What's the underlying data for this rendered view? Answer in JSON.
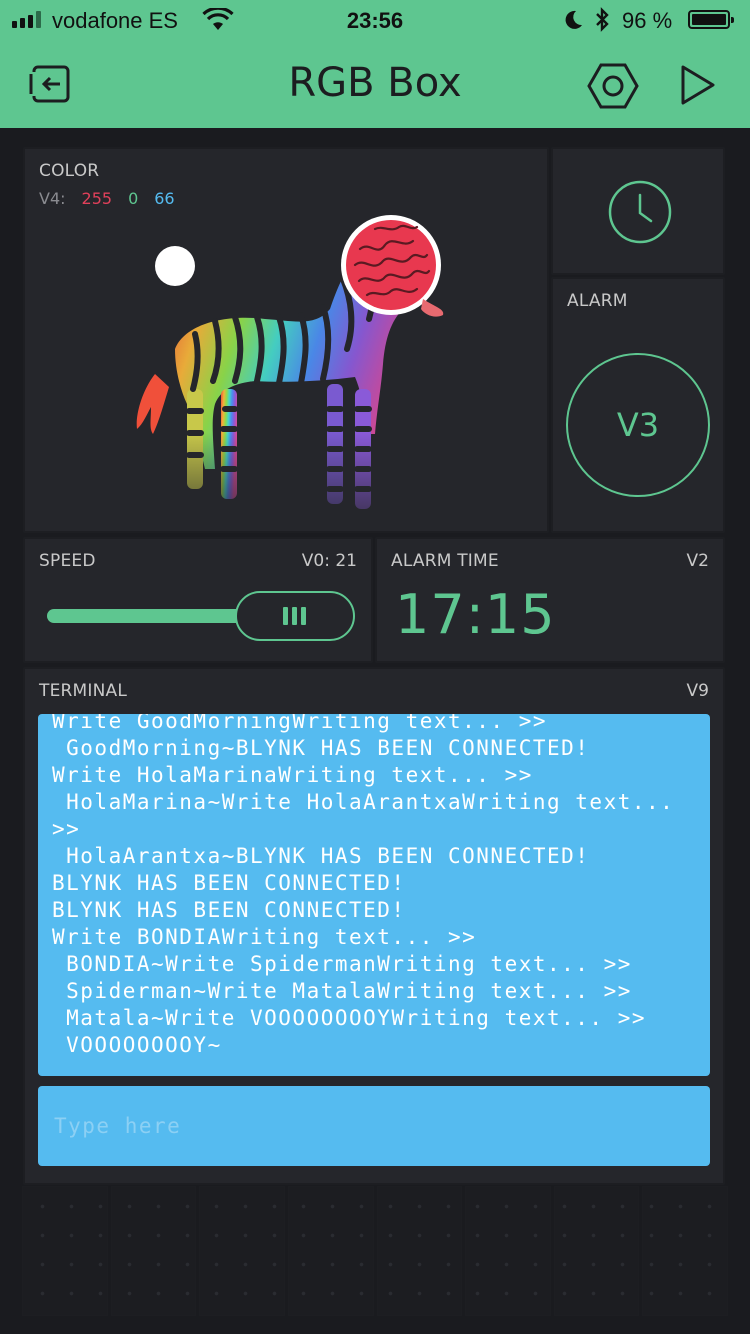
{
  "status_bar": {
    "carrier": "vodafone ES",
    "time": "23:56",
    "battery_percent": "96 %",
    "battery_level": 0.96,
    "icons": [
      "signal-icon",
      "wifi-icon",
      "moon-icon",
      "bluetooth-icon",
      "battery-icon"
    ]
  },
  "navbar": {
    "title": "RGB Box",
    "left_icon": "exit-icon",
    "right_icons": [
      "settings-hexagon-icon",
      "play-icon"
    ]
  },
  "colors": {
    "accent": "#5ec690",
    "panel": "#25262b",
    "background": "#1a1b1f",
    "terminal": "#55bbf0",
    "red_value": "#e0405a",
    "green_value": "#5ec690",
    "blue_value": "#55bbf0"
  },
  "color_widget": {
    "label": "COLOR",
    "pin": "V4:",
    "r": "255",
    "g": "0",
    "b": "66",
    "selected_color": "#e8384f"
  },
  "timer_widget": {
    "icon": "clock-icon"
  },
  "alarm_widget": {
    "label": "ALARM",
    "button_label": "V3"
  },
  "speed_widget": {
    "label": "SPEED",
    "value_label": "V0: 21",
    "slider_fraction": 0.9
  },
  "alarm_time_widget": {
    "label": "ALARM TIME",
    "pin": "V2",
    "value": "17:15"
  },
  "terminal": {
    "label": "TERMINAL",
    "pin": "V9",
    "lines": [
      "Write GoodMorningWriting text... >>",
      " GoodMorning~BLYNK HAS BEEN CONNECTED!",
      "Write HolaMarinaWriting text... >>",
      " HolaMarina~Write HolaArantxaWriting text...",
      ">>",
      " HolaArantxa~BLYNK HAS BEEN CONNECTED!",
      "BLYNK HAS BEEN CONNECTED!",
      "BLYNK HAS BEEN CONNECTED!",
      "Write BONDIAWriting text... >>",
      " BONDIA~Write SpidermanWriting text... >>",
      " Spiderman~Write MatalaWriting text... >>",
      " Matala~Write VOOOOOOOOYWriting text... >>",
      " VOOOOOOOOY~"
    ],
    "input_placeholder": "Type here"
  }
}
